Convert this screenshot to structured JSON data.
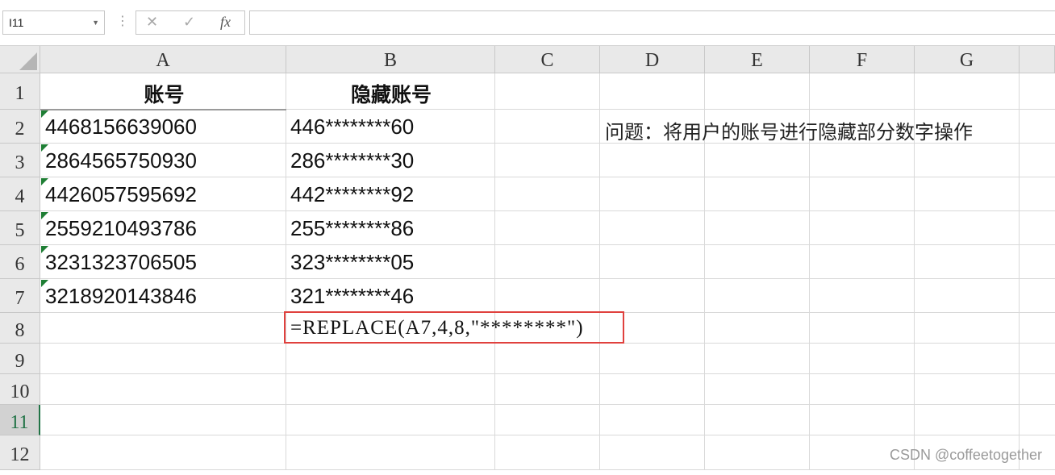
{
  "formula_bar": {
    "name_box": "I11",
    "cancel_icon": "✕",
    "enter_icon": "✓",
    "fx_label": "fx",
    "content": ""
  },
  "columns": [
    "A",
    "B",
    "C",
    "D",
    "E",
    "F",
    "G"
  ],
  "rows": [
    "1",
    "2",
    "3",
    "4",
    "5",
    "6",
    "7",
    "8",
    "9",
    "10",
    "11",
    "12"
  ],
  "selected_row": "11",
  "headers": {
    "a1": "账号",
    "b1": "隐藏账号"
  },
  "accounts": [
    {
      "original": "4468156639060",
      "hidden": "446********60"
    },
    {
      "original": "2864565750930",
      "hidden": "286********30"
    },
    {
      "original": "4426057595692",
      "hidden": "442********92"
    },
    {
      "original": "2559210493786",
      "hidden": "255********86"
    },
    {
      "original": "3231323706505",
      "hidden": "323********05"
    },
    {
      "original": "3218920143846",
      "hidden": "321********46"
    }
  ],
  "note": "问题：将用户的账号进行隐藏部分数字操作",
  "formula_text": "=REPLACE(A7,4,8,\"********\")",
  "watermark": "CSDN @coffeetogether",
  "colors": {
    "grid": "#d9d9d9",
    "header_bg": "#e9e9e9",
    "selection": "#217346",
    "highlight_box": "#e0413e",
    "error_indicator": "#1e7e34"
  }
}
